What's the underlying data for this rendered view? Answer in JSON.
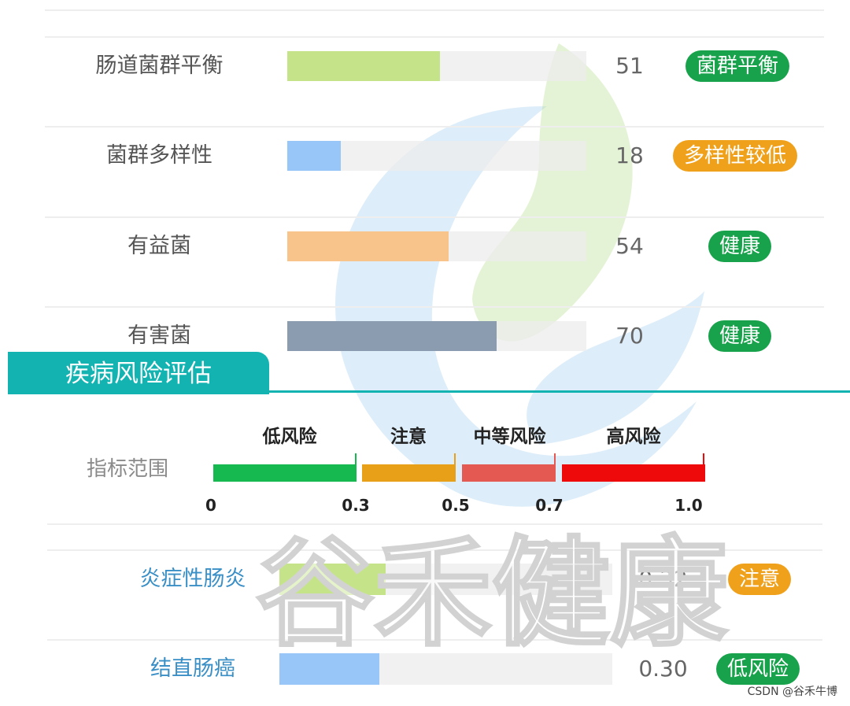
{
  "metrics": [
    {
      "label": "肠道菌群平衡",
      "value": "51",
      "fill_percent": 51,
      "bar_color": "#c5e48a",
      "status": "菌群平衡",
      "status_color": "#17a24b"
    },
    {
      "label": "菌群多样性",
      "value": "18",
      "fill_percent": 18,
      "bar_color": "#98c6f8",
      "status": "多样性较低",
      "status_color": "#f0a11c"
    },
    {
      "label": "有益菌",
      "value": "54",
      "fill_percent": 54,
      "bar_color": "#f8c48c",
      "status": "健康",
      "status_color": "#17a24b"
    },
    {
      "label": "有害菌",
      "value": "70",
      "fill_percent": 70,
      "bar_color": "#8b9bb0",
      "status": "健康",
      "status_color": "#17a24b"
    }
  ],
  "section": {
    "title": "疾病风险评估",
    "color": "#13b3b2"
  },
  "risk_scale": {
    "label": "指标范围",
    "categories": [
      {
        "name": "低风险",
        "from": 0,
        "to": 0.3,
        "color": "#16b850"
      },
      {
        "name": "注意",
        "from": 0.3,
        "to": 0.5,
        "color": "#e8a018"
      },
      {
        "name": "中等风险",
        "from": 0.5,
        "to": 0.7,
        "color": "#e45a52"
      },
      {
        "name": "高风险",
        "from": 0.7,
        "to": 1.0,
        "color": "#ee0a0a"
      }
    ],
    "ticks": [
      "0",
      "0.3",
      "0.5",
      "0.7",
      "1.0"
    ]
  },
  "diseases": [
    {
      "label": "炎症性肠炎",
      "value": "0.32",
      "fill_fraction": 0.32,
      "bar_color": "#c5e48a",
      "status": "注意",
      "status_color": "#f0a11c"
    },
    {
      "label": "结直肠癌",
      "value": "0.30",
      "fill_fraction": 0.3,
      "bar_color": "#98c6f8",
      "status": "低风险",
      "status_color": "#17a24b"
    }
  ],
  "watermark": {
    "text": "谷禾健康",
    "icon": "flame-logo-icon"
  },
  "credit": "CSDN @谷禾牛博"
}
